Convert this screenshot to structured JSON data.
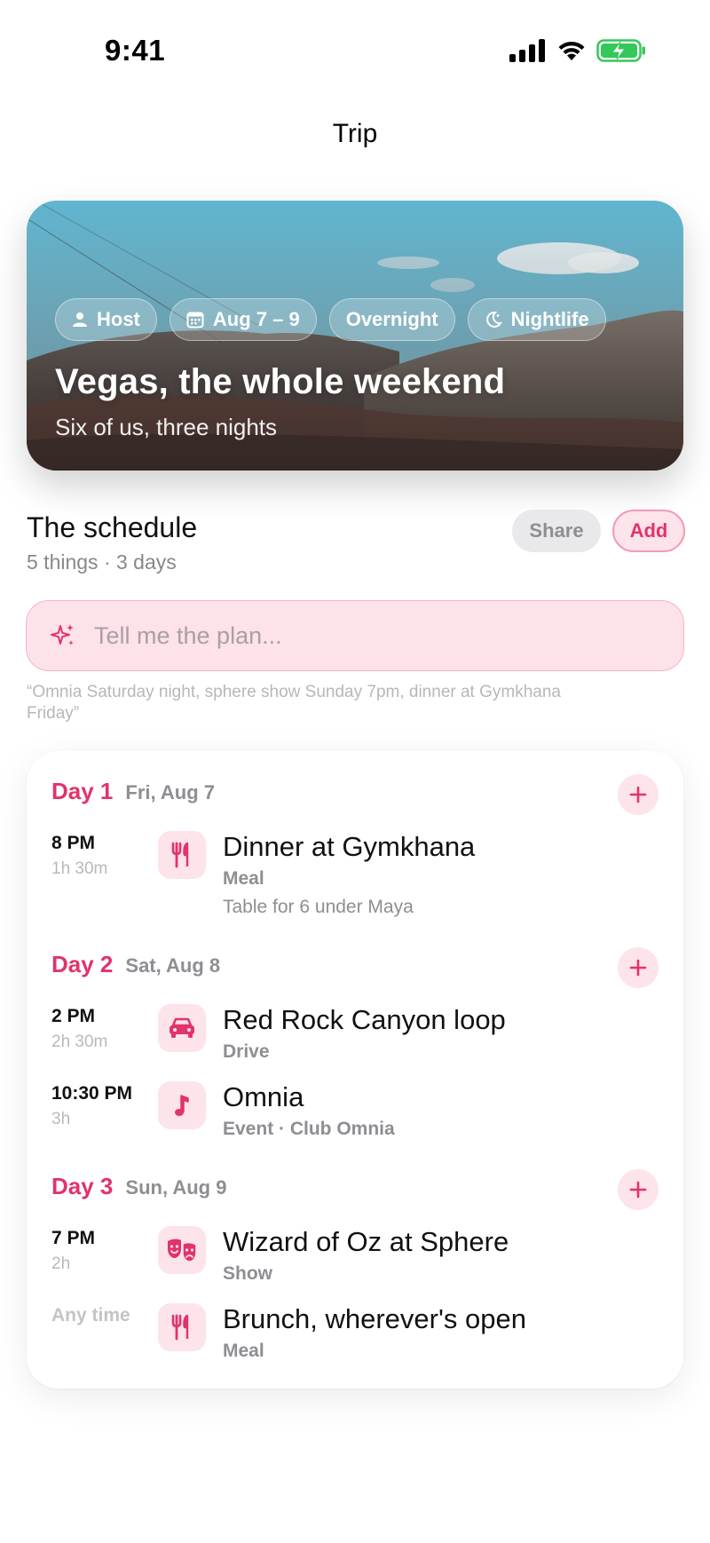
{
  "status": {
    "time": "9:41"
  },
  "nav": {
    "title": "Trip"
  },
  "hero": {
    "chips": [
      {
        "icon": "person-icon",
        "label": "Host"
      },
      {
        "icon": "calendar-icon",
        "label": "Aug 7 – 9"
      },
      {
        "icon": "",
        "label": "Overnight"
      },
      {
        "icon": "moon-icon",
        "label": "Nightlife"
      }
    ],
    "title": "Vegas, the whole weekend",
    "subtitle": "Six of us, three nights"
  },
  "schedule": {
    "title": "The schedule",
    "subtitle": "5 things · 3 days",
    "share_label": "Share",
    "add_label": "Add"
  },
  "plan": {
    "placeholder": "Tell me the plan...",
    "hint": "“Omnia Saturday night, sphere show Sunday 7pm, dinner at Gymkhana Friday”"
  },
  "days": [
    {
      "label": "Day 1",
      "date": "Fri, Aug 7",
      "items": [
        {
          "time": "8 PM",
          "duration": "1h 30m",
          "icon": "fork-knife-icon",
          "title": "Dinner at Gymkhana",
          "category": "Meal",
          "note": "Table for 6 under Maya"
        }
      ]
    },
    {
      "label": "Day 2",
      "date": "Sat, Aug 8",
      "items": [
        {
          "time": "2 PM",
          "duration": "2h 30m",
          "icon": "car-icon",
          "title": "Red Rock Canyon loop",
          "category": "Drive"
        },
        {
          "time": "10:30 PM",
          "duration": "3h",
          "icon": "music-note-icon",
          "title": "Omnia",
          "category": "Event · Club Omnia"
        }
      ]
    },
    {
      "label": "Day 3",
      "date": "Sun, Aug 9",
      "items": [
        {
          "time": "7 PM",
          "duration": "2h",
          "icon": "theater-masks-icon",
          "title": "Wizard of Oz at Sphere",
          "category": "Show"
        },
        {
          "time": "Any time",
          "duration": "",
          "icon": "fork-knife-icon",
          "title": "Brunch, wherever's open",
          "category": "Meal"
        }
      ]
    }
  ],
  "colors": {
    "accent": "#e2336b",
    "accent_soft": "#fde3ea",
    "muted": "#8e8e93",
    "battery": "#34c759"
  }
}
